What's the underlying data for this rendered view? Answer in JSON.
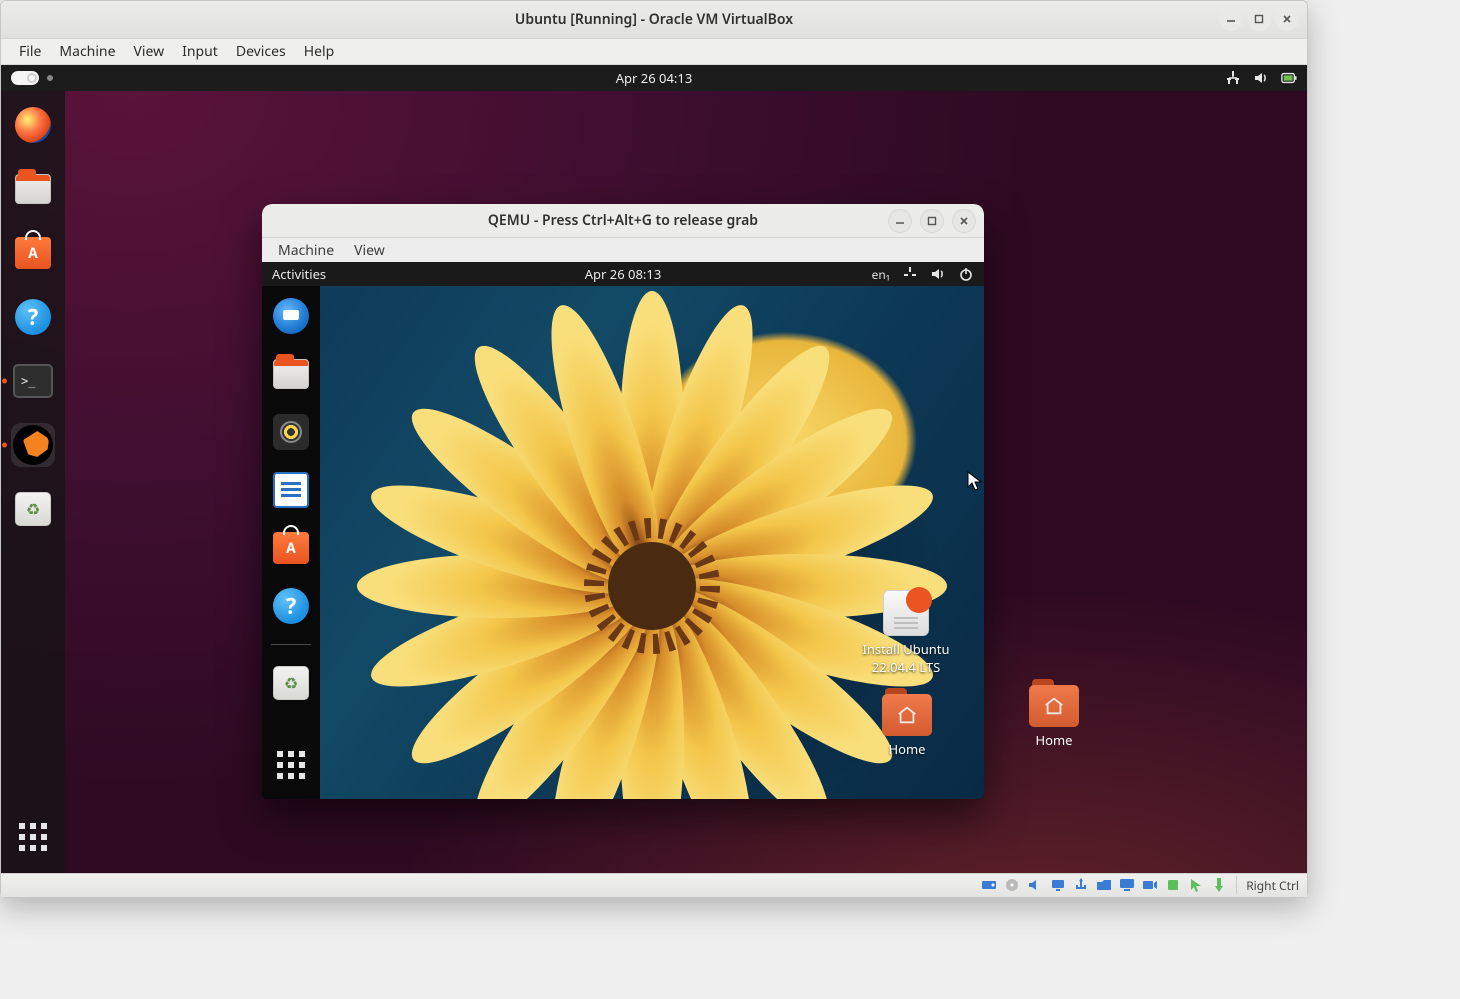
{
  "host_window": {
    "title": "Ubuntu [Running] - Oracle VM VirtualBox",
    "menu": [
      "File",
      "Machine",
      "View",
      "Input",
      "Devices",
      "Help"
    ],
    "status_bar": {
      "icons": [
        "hdd-icon",
        "cd-icon",
        "audio-icon",
        "net-icon",
        "usb-icon",
        "shared-folder-icon",
        "clipboard-icon",
        "display-icon",
        "recording-icon",
        "video-capture-icon",
        "cpu-icon",
        "mouse-icon",
        "keyboard-icon"
      ],
      "host_key": "Right Ctrl"
    }
  },
  "outer_session": {
    "topbar": {
      "clock": "Apr 26  04:13"
    },
    "dock": [
      {
        "name": "firefox",
        "label": "Firefox"
      },
      {
        "name": "files",
        "label": "Files"
      },
      {
        "name": "ubuntu-software",
        "label": "Ubuntu Software"
      },
      {
        "name": "help",
        "label": "Help",
        "glyph": "?"
      },
      {
        "name": "terminal",
        "label": "Terminal",
        "glyph": ">_",
        "running": true
      },
      {
        "name": "qemu",
        "label": "QEMU",
        "running": true,
        "active": true
      },
      {
        "name": "trash",
        "label": "Trash",
        "glyph": "♻"
      }
    ],
    "desktop_icons": [
      {
        "name": "home",
        "label": "Home"
      }
    ]
  },
  "qemu_window": {
    "title": "QEMU - Press Ctrl+Alt+G to release grab",
    "menu": [
      "Machine",
      "View"
    ]
  },
  "inner_session": {
    "topbar": {
      "activities": "Activities",
      "clock": "Apr 26  08:13",
      "lang": "en₁"
    },
    "dock": [
      {
        "name": "thunderbird",
        "label": "Thunderbird"
      },
      {
        "name": "files",
        "label": "Files"
      },
      {
        "name": "rhythmbox",
        "label": "Rhythmbox"
      },
      {
        "name": "writer",
        "label": "LibreOffice Writer"
      },
      {
        "name": "ubuntu-software",
        "label": "Ubuntu Software"
      },
      {
        "name": "help",
        "label": "Help",
        "glyph": "?"
      },
      {
        "name": "trash",
        "label": "Trash",
        "glyph": "♻"
      }
    ],
    "desktop_icons": [
      {
        "name": "install-ubuntu",
        "label": "Install Ubuntu 22.04.4 LTS"
      },
      {
        "name": "home",
        "label": "Home"
      }
    ]
  }
}
